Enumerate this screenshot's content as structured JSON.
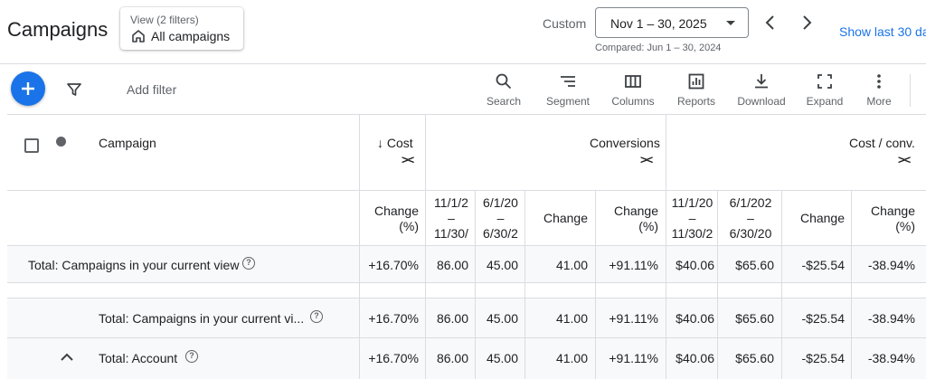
{
  "header": {
    "title": "Campaigns",
    "view_sub": "View (2 filters)",
    "view_main": "All campaigns",
    "custom_label": "Custom",
    "date_range": "Nov 1 – 30, 2025",
    "compared": "Compared: Jun 1 – 30, 2024",
    "show_last": "Show last 30 da"
  },
  "toolbar": {
    "add_filter": "Add filter",
    "tools": [
      {
        "label": "Search",
        "icon": "search-icon"
      },
      {
        "label": "Segment",
        "icon": "segment-icon"
      },
      {
        "label": "Columns",
        "icon": "columns-icon"
      },
      {
        "label": "Reports",
        "icon": "reports-icon"
      },
      {
        "label": "Download",
        "icon": "download-icon"
      },
      {
        "label": "Expand",
        "icon": "expand-icon"
      },
      {
        "label": "More",
        "icon": "more-vert-icon"
      }
    ]
  },
  "table": {
    "col_campaign": "Campaign",
    "col_cost": "↓ Cost",
    "col_conversions": "Conversions",
    "col_cost_conv": "Cost / conv.",
    "expand_glyph": "><",
    "subheaders": {
      "cost_change_pct_1": "Change",
      "cost_change_pct_2": "(%)",
      "conv_cur_1": "11/1/2",
      "conv_cur_2": "–",
      "conv_cur_3": "11/30/",
      "conv_prev_1": "6/1/20",
      "conv_prev_2": "–",
      "conv_prev_3": "6/30/2",
      "conv_change": "Change",
      "conv_change_pct_1": "Change",
      "conv_change_pct_2": "(%)",
      "cpc_cur_1": "11/1/20",
      "cpc_cur_2": "–",
      "cpc_cur_3": "11/30/2",
      "cpc_prev_1": "6/1/202",
      "cpc_prev_2": "–",
      "cpc_prev_3": "6/30/20",
      "cpc_change": "Change",
      "cpc_change_pct_1": "Change",
      "cpc_change_pct_2": "(%)"
    },
    "rows": [
      {
        "label": "Total: Campaigns in your current view",
        "values": [
          "+16.70%",
          "86.00",
          "45.00",
          "41.00",
          "+91.11%",
          "$40.06",
          "$65.60",
          "-$25.54",
          "-38.94%"
        ]
      },
      {
        "label": "Total: Campaigns in your current vi...",
        "values": [
          "+16.70%",
          "86.00",
          "45.00",
          "41.00",
          "+91.11%",
          "$40.06",
          "$65.60",
          "-$25.54",
          "-38.94%"
        ]
      },
      {
        "label": "Total: Account",
        "values": [
          "+16.70%",
          "86.00",
          "45.00",
          "41.00",
          "+91.11%",
          "$40.06",
          "$65.60",
          "-$25.54",
          "-38.94%"
        ]
      }
    ],
    "help_glyph": "?"
  }
}
